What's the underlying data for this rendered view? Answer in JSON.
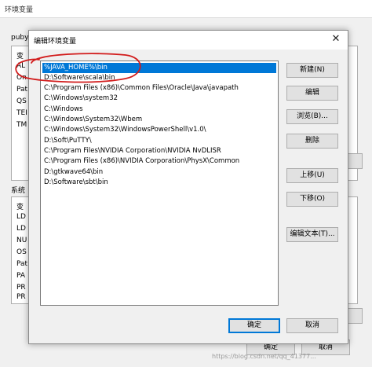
{
  "background_window": {
    "title": "环境变量",
    "user_section_label": "puby",
    "user_rows": [
      "变",
      "AL",
      "On",
      "Pat",
      "QS",
      "TEI",
      "TM"
    ],
    "system_section_label": "系统",
    "system_rows": [
      "变",
      "LD",
      "LD",
      "NU",
      "OS",
      "Pat",
      "PA",
      "PR",
      "PR"
    ],
    "ok_label": "确定",
    "cancel_label": "取消",
    "watermark": "https://blog.csdn.net/qq_41377..."
  },
  "dialog": {
    "title": "编辑环境变量",
    "close_glyph": "✕",
    "paths": [
      "%JAVA_HOME%\\bin",
      "D:\\Software\\scala\\bin",
      "C:\\Program Files (x86)\\Common Files\\Oracle\\Java\\javapath",
      "C:\\Windows\\system32",
      "C:\\Windows",
      "C:\\Windows\\System32\\Wbem",
      "C:\\Windows\\System32\\WindowsPowerShell\\v1.0\\",
      "D:\\Soft\\PuTTY\\",
      "C:\\Program Files\\NVIDIA Corporation\\NVIDIA NvDLISR",
      "C:\\Program Files (x86)\\NVIDIA Corporation\\PhysX\\Common",
      "D:\\gtkwave64\\bin",
      "D:\\Software\\sbt\\bin"
    ],
    "buttons": {
      "new": "新建(N)",
      "edit": "编辑",
      "browse": "浏览(B)...",
      "delete": "删除",
      "move_up": "上移(U)",
      "move_down": "下移(O)",
      "edit_text": "编辑文本(T)...",
      "ok": "确定",
      "cancel": "取消"
    }
  },
  "colors": {
    "selection": "#0078d7",
    "annotation": "#d21c1c"
  }
}
